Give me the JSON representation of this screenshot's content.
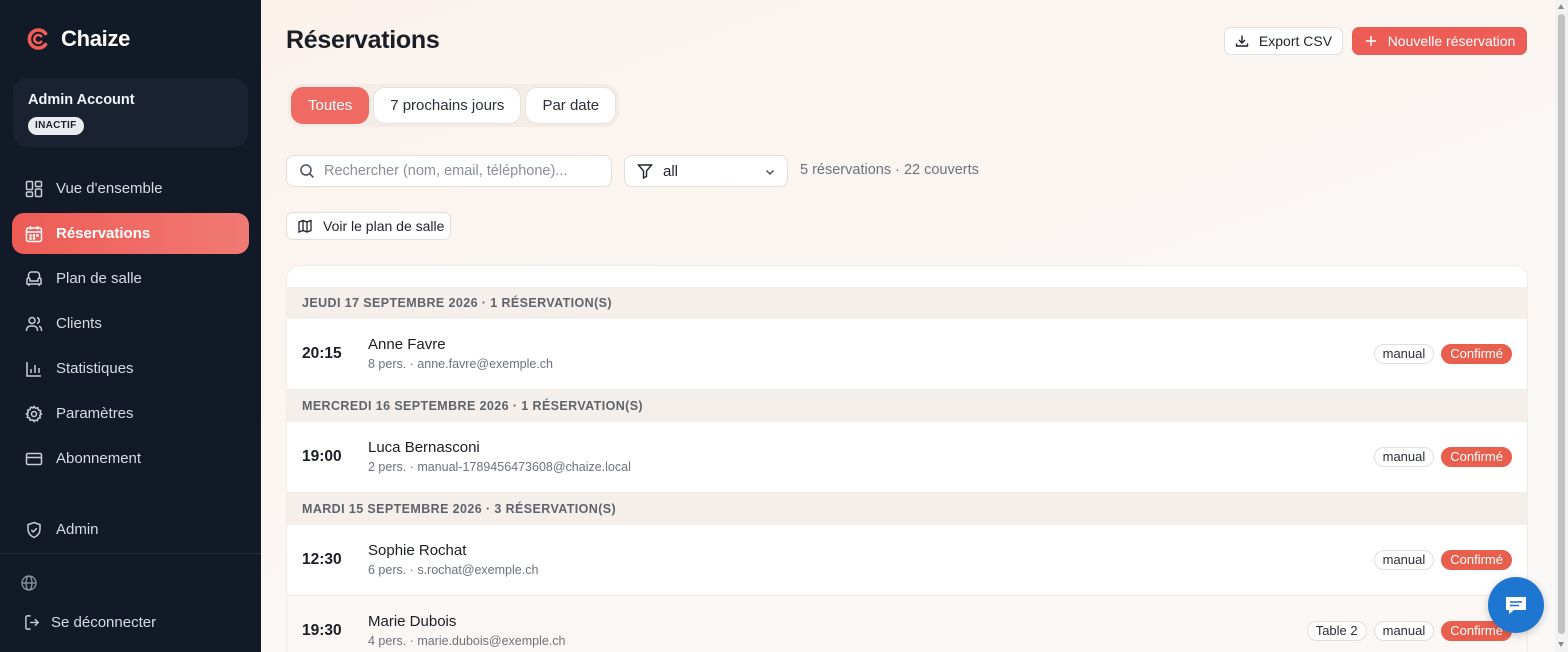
{
  "app": {
    "name": "Chaize"
  },
  "account": {
    "name": "Admin Account",
    "badge": "INACTIF"
  },
  "sidebar": {
    "items": [
      {
        "label": "Vue d'ensemble",
        "icon": "dashboard-icon"
      },
      {
        "label": "Réservations",
        "icon": "calendar-icon",
        "active": true
      },
      {
        "label": "Plan de salle",
        "icon": "armchair-icon"
      },
      {
        "label": "Clients",
        "icon": "users-icon"
      },
      {
        "label": "Statistiques",
        "icon": "bar-chart-icon"
      },
      {
        "label": "Paramètres",
        "icon": "gear-icon"
      },
      {
        "label": "Abonnement",
        "icon": "credit-card-icon"
      }
    ],
    "admin": {
      "label": "Admin",
      "icon": "shield-icon"
    },
    "logout": "Se déconnecter"
  },
  "header": {
    "title": "Réservations",
    "export_label": "Export CSV",
    "new_label": "Nouvelle réservation"
  },
  "tabs": [
    {
      "label": "Toutes",
      "active": true
    },
    {
      "label": "7 prochains jours"
    },
    {
      "label": "Par date"
    }
  ],
  "search": {
    "placeholder": "Rechercher (nom, email, téléphone)...",
    "value": ""
  },
  "filter": {
    "value": "all"
  },
  "summary": "5 réservations · 22 couverts",
  "plan_button": "Voir le plan de salle",
  "groups": [
    {
      "header": "JEUDI 17 SEPTEMBRE 2026 · 1 RÉSERVATION(S)",
      "reservations": [
        {
          "time": "20:15",
          "name": "Anne Favre",
          "meta": "8 pers. · anne.favre@exemple.ch",
          "source": "manual",
          "status": "Confirmé"
        }
      ]
    },
    {
      "header": "MERCREDI 16 SEPTEMBRE 2026 · 1 RÉSERVATION(S)",
      "reservations": [
        {
          "time": "19:00",
          "name": "Luca Bernasconi",
          "meta": "2 pers. · manual-1789456473608@chaize.local",
          "source": "manual",
          "status": "Confirmé"
        }
      ]
    },
    {
      "header": "MARDI 15 SEPTEMBRE 2026 · 3 RÉSERVATION(S)",
      "reservations": [
        {
          "time": "12:30",
          "name": "Sophie Rochat",
          "meta": "6 pers. · s.rochat@exemple.ch",
          "source": "manual",
          "status": "Confirmé"
        },
        {
          "time": "19:30",
          "name": "Marie Dubois",
          "meta": "4 pers. · marie.dubois@exemple.ch",
          "table": "Table 2",
          "source": "manual",
          "status": "Confirmé"
        }
      ]
    }
  ],
  "colors": {
    "accent": "#ee5d55",
    "sidebar_bg": "#121a27",
    "status_confirmed": "#e85f4e",
    "chat": "#1f76d0"
  }
}
